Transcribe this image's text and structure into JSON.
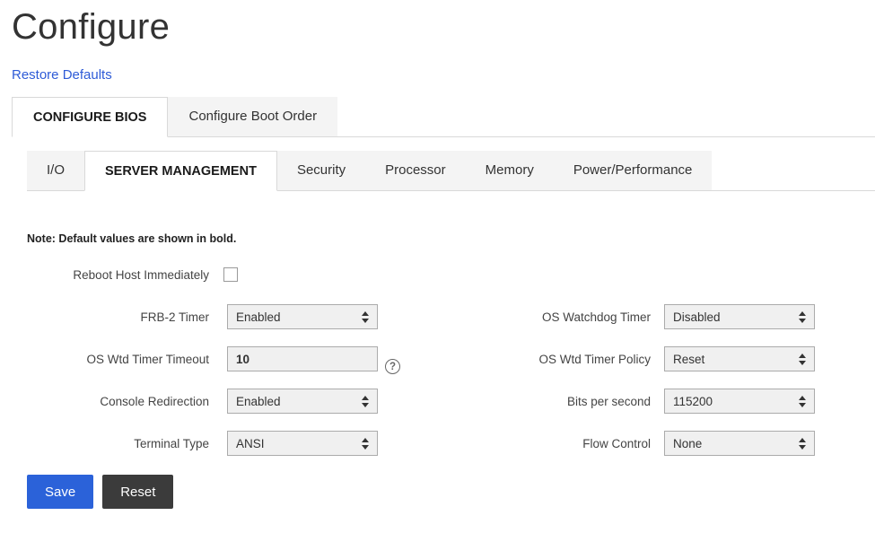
{
  "page": {
    "title": "Configure",
    "restore_defaults_label": "Restore Defaults"
  },
  "tabs": {
    "main": [
      {
        "label": "CONFIGURE BIOS",
        "active": true
      },
      {
        "label": "Configure Boot Order",
        "active": false
      }
    ],
    "sub": [
      {
        "label": "I/O",
        "active": false
      },
      {
        "label": "SERVER MANAGEMENT",
        "active": true
      },
      {
        "label": "Security",
        "active": false
      },
      {
        "label": "Processor",
        "active": false
      },
      {
        "label": "Memory",
        "active": false
      },
      {
        "label": "Power/Performance",
        "active": false
      }
    ]
  },
  "form": {
    "note": "Note: Default values are shown in bold.",
    "fields": {
      "reboot_host_immediately": {
        "label": "Reboot Host Immediately",
        "checked": false
      },
      "frb2_timer": {
        "label": "FRB-2 Timer",
        "value": "Enabled"
      },
      "os_watchdog_timer": {
        "label": "OS Watchdog Timer",
        "value": "Disabled"
      },
      "os_wtd_timer_timeout": {
        "label": "OS Wtd Timer Timeout",
        "value": "10"
      },
      "os_wtd_timer_policy": {
        "label": "OS Wtd Timer Policy",
        "value": "Reset"
      },
      "console_redirection": {
        "label": "Console Redirection",
        "value": "Enabled"
      },
      "bits_per_second": {
        "label": "Bits per second",
        "value": "115200"
      },
      "terminal_type": {
        "label": "Terminal Type",
        "value": "ANSI"
      },
      "flow_control": {
        "label": "Flow Control",
        "value": "None"
      }
    },
    "help_icon_glyph": "?"
  },
  "buttons": {
    "save": "Save",
    "reset": "Reset"
  },
  "colors": {
    "accent_blue": "#2b62d9",
    "link_blue": "#2e5bd7",
    "dark_button": "#3b3b3b",
    "tab_inactive_bg": "#f4f4f4",
    "control_bg": "#f0f0f0",
    "control_border": "#ababab"
  }
}
